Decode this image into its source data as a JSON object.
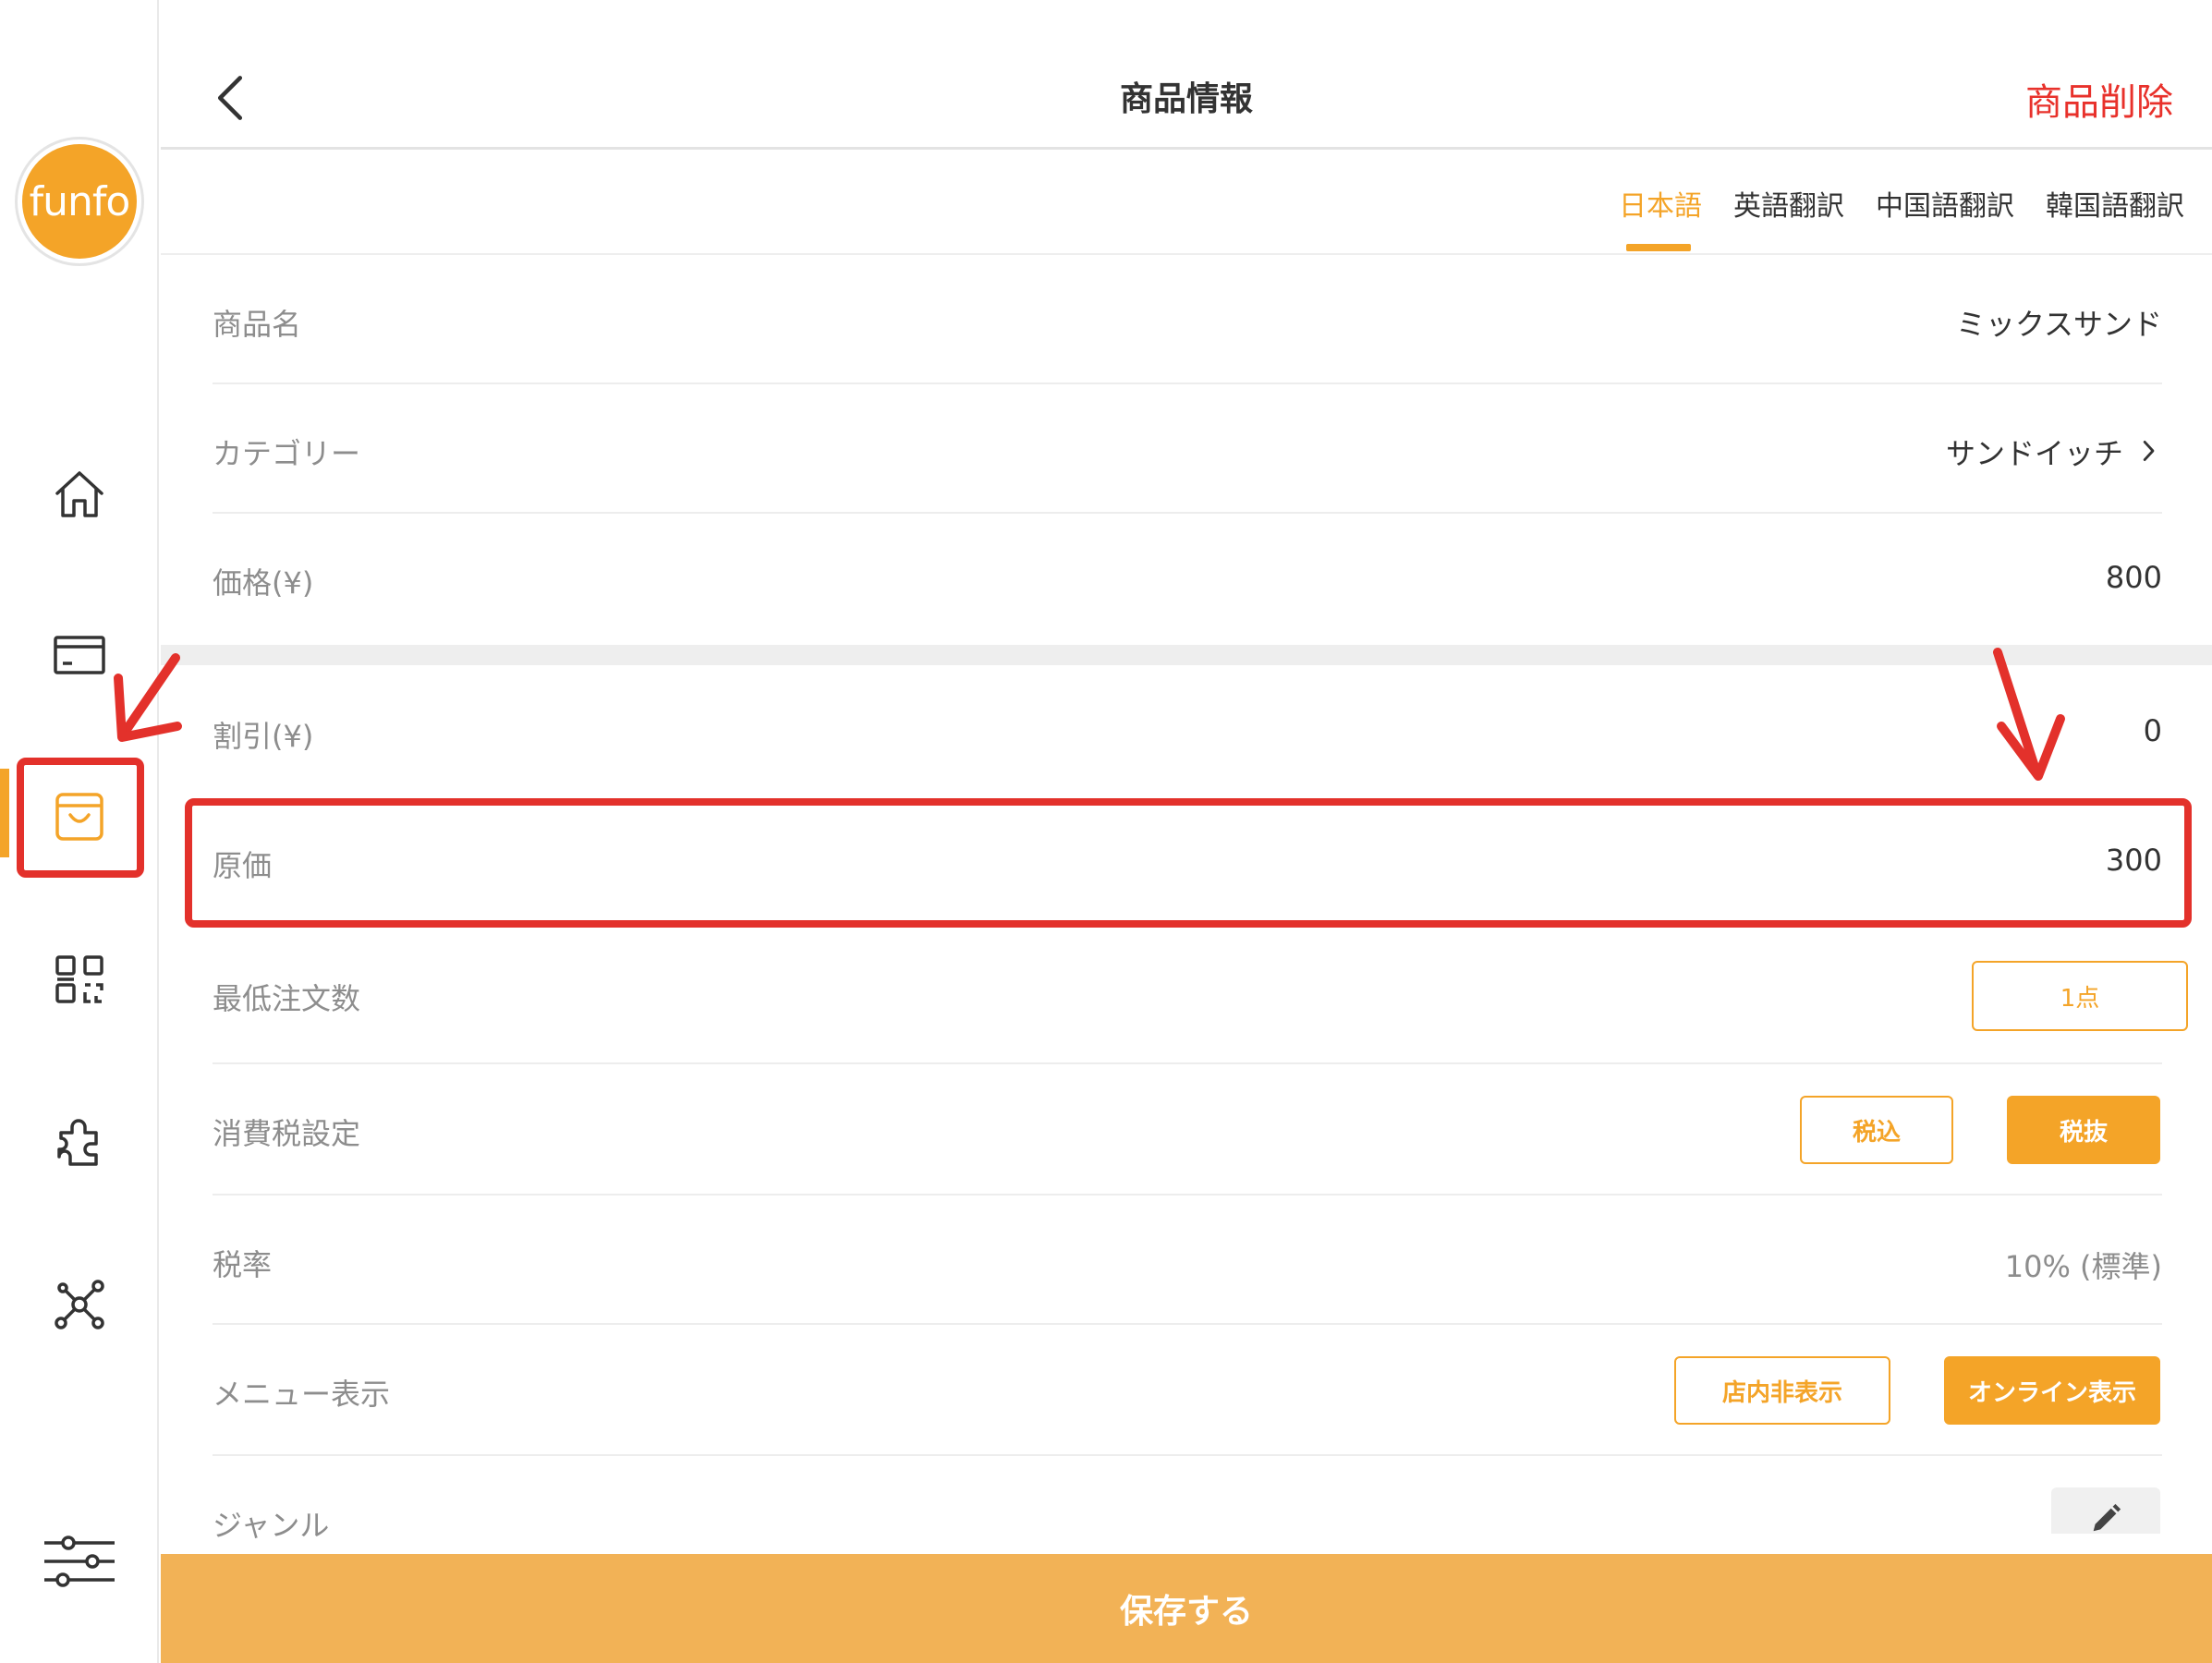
{
  "sidebar": {
    "logo_text": "funfo",
    "icons": [
      "home-icon",
      "card-icon",
      "bag-icon",
      "qr-icon",
      "puzzle-icon",
      "network-icon",
      "settings-sliders-icon"
    ],
    "active_icon": "bag-icon"
  },
  "header": {
    "title": "商品情報",
    "delete_label": "商品削除"
  },
  "tabs": [
    {
      "label": "日本語",
      "active": true
    },
    {
      "label": "英語翻訳",
      "active": false
    },
    {
      "label": "中国語翻訳",
      "active": false
    },
    {
      "label": "韓国語翻訳",
      "active": false
    }
  ],
  "form": {
    "product_name": {
      "label": "商品名",
      "value": "ミックスサンド"
    },
    "category": {
      "label": "カテゴリー",
      "value": "サンドイッチ"
    },
    "price": {
      "label": "価格(¥)",
      "value": "800"
    },
    "discount": {
      "label": "割引(¥)",
      "value": "0"
    },
    "cost": {
      "label": "原価",
      "value": "300"
    },
    "min_order": {
      "label": "最低注文数",
      "button": "1点"
    },
    "tax_setting": {
      "label": "消費税設定",
      "options": [
        "税込",
        "税抜"
      ],
      "selected": "税抜"
    },
    "tax_rate": {
      "label": "税率",
      "value": "10% (標準)"
    },
    "menu_display": {
      "label": "メニュー表示",
      "options": [
        "店内非表示",
        "オンライン表示"
      ],
      "selected": "オンライン表示"
    },
    "genre": {
      "label": "ジャンル"
    }
  },
  "footer": {
    "save_label": "保存する"
  },
  "colors": {
    "accent": "#f4a428",
    "save_bar": "#f2b256",
    "danger": "#e8312b",
    "annotation": "#e3312b"
  }
}
